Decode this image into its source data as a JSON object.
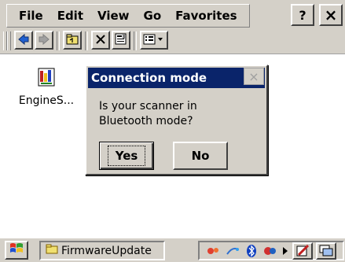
{
  "menu": {
    "items": [
      "File",
      "Edit",
      "View",
      "Go",
      "Favorites"
    ]
  },
  "titlebar": {
    "help_label": "?",
    "close_label": "×"
  },
  "toolbar": {
    "icons": [
      "back-icon",
      "forward-icon",
      "up-folder-icon",
      "delete-icon",
      "properties-icon",
      "view-menu-icon"
    ]
  },
  "desktop": {
    "file_label": "EngineS..."
  },
  "dialog": {
    "title": "Connection mode",
    "close_label": "×",
    "message_line1": "Is your scanner in",
    "message_line2": "Bluetooth mode?",
    "yes_label": "Yes",
    "no_label": "No"
  },
  "taskbar": {
    "task_label": "FirmwareUpdate",
    "tray_icons": [
      "network-icon",
      "connection-icon",
      "bluetooth-icon",
      "sync-icon",
      "arrow-icon",
      "pen-icon",
      "desktop-icon"
    ]
  },
  "colors": {
    "title_bar": "#0a246a",
    "chrome": "#d4d0c8"
  }
}
